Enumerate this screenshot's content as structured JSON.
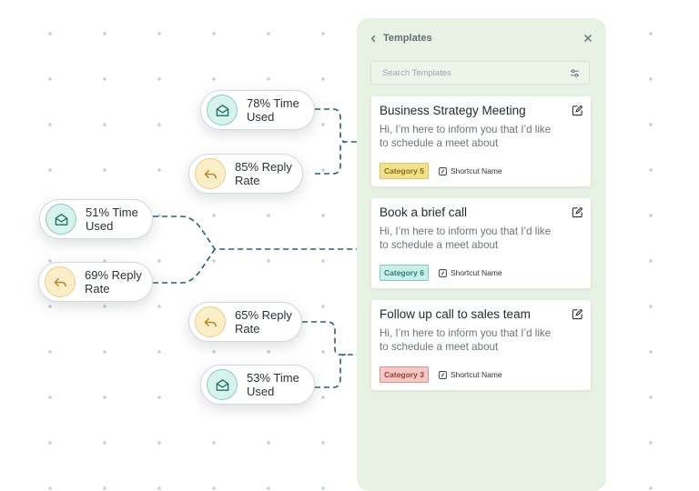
{
  "panel": {
    "title": "Templates",
    "search_placeholder": "Search Templates",
    "templates": [
      {
        "title": "Business Strategy Meeting",
        "body": "Hi, I’m here to inform you that I’d like to schedule a meet about",
        "category": "Category 5",
        "shortcut": "Shortcut Name"
      },
      {
        "title": "Book a brief call",
        "body": "Hi, I’m here to inform you that I’d like to schedule a meet about",
        "category": "Category 6",
        "shortcut": "Shortcut Name"
      },
      {
        "title": "Follow up call to sales team",
        "body": "Hi, I’m here to inform you that I’d like to schedule a meet about",
        "category": "Category 3",
        "shortcut": "Shortcut Name"
      }
    ]
  },
  "stats": [
    {
      "text": "78% Time Used",
      "icon": "mail-open-icon"
    },
    {
      "text": "85% Reply Rate",
      "icon": "reply-icon"
    },
    {
      "text": "51% Time Used",
      "icon": "mail-open-icon"
    },
    {
      "text": "69% Reply Rate",
      "icon": "reply-icon"
    },
    {
      "text": "65% Reply Rate",
      "icon": "reply-icon"
    },
    {
      "text": "53% Time Used",
      "icon": "mail-open-icon"
    }
  ],
  "colors": {
    "panel_bg": "#e8f2e4",
    "category_5": "#f2e08f",
    "category_6": "#c8efe8",
    "category_3": "#f6c9c7",
    "connector": "#2f5d6e"
  }
}
